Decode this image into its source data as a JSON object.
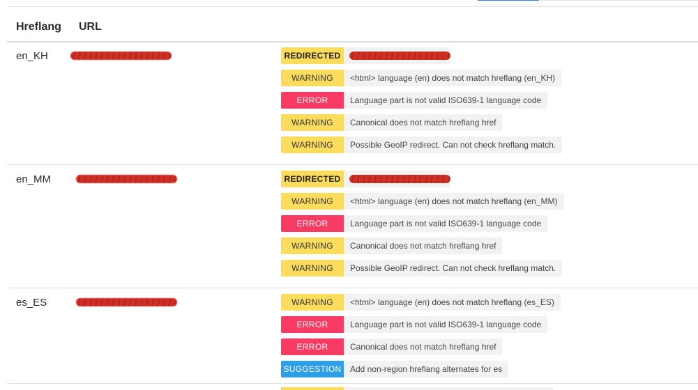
{
  "table": {
    "headers": {
      "hreflang": "Hreflang",
      "url": "URL"
    },
    "rows": [
      {
        "hreflang": "en_KH",
        "issues": [
          {
            "type": "redirected",
            "label": "REDIRECTED",
            "message": ""
          },
          {
            "type": "warning",
            "label": "WARNING",
            "message": "<html> language (en) does not match hreflang (en_KH)"
          },
          {
            "type": "error",
            "label": "ERROR",
            "message": "Language part is not valid ISO639-1 language code"
          },
          {
            "type": "warning",
            "label": "WARNING",
            "message": "Canonical does not match hreflang href"
          },
          {
            "type": "warning",
            "label": "WARNING",
            "message": "Possible GeoIP redirect. Can not check hreflang match."
          }
        ]
      },
      {
        "hreflang": "en_MM",
        "issues": [
          {
            "type": "redirected",
            "label": "REDIRECTED",
            "message": ""
          },
          {
            "type": "warning",
            "label": "WARNING",
            "message": "<html> language (en) does not match hreflang (en_MM)"
          },
          {
            "type": "error",
            "label": "ERROR",
            "message": "Language part is not valid ISO639-1 language code"
          },
          {
            "type": "warning",
            "label": "WARNING",
            "message": "Canonical does not match hreflang href"
          },
          {
            "type": "warning",
            "label": "WARNING",
            "message": "Possible GeoIP redirect. Can not check hreflang match."
          }
        ]
      },
      {
        "hreflang": "es_ES",
        "issues": [
          {
            "type": "warning",
            "label": "WARNING",
            "message": "<html> language (en) does not match hreflang (es_ES)"
          },
          {
            "type": "error",
            "label": "ERROR",
            "message": "Language part is not valid ISO639-1 language code"
          },
          {
            "type": "error",
            "label": "ERROR",
            "message": "Canonical does not match hreflang href"
          },
          {
            "type": "suggestion",
            "label": "SUGGESTION",
            "message": "Add non-region hreflang alternates for es"
          }
        ]
      }
    ]
  },
  "colors": {
    "warning": "#fbdc5c",
    "error": "#f93b63",
    "suggestion": "#2d9fe6",
    "message_bg": "#f2f2f2",
    "redaction": "#c0261c"
  }
}
